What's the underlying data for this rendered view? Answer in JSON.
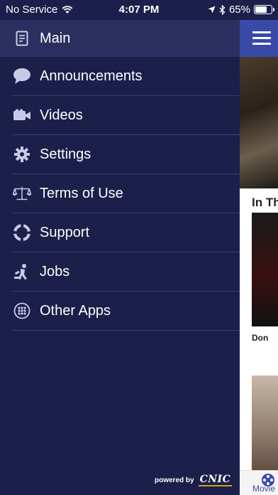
{
  "status": {
    "carrier": "No Service",
    "time": "4:07 PM",
    "battery": "65%",
    "battery_level": 0.65
  },
  "menu": [
    {
      "label": "Main",
      "icon": "document-icon",
      "active": true
    },
    {
      "label": "Announcements",
      "icon": "speech-bubble-icon"
    },
    {
      "label": "Videos",
      "icon": "video-camera-icon"
    },
    {
      "label": "Settings",
      "icon": "gear-icon"
    },
    {
      "label": "Terms of Use",
      "icon": "scales-icon"
    },
    {
      "label": "Support",
      "icon": "lifebuoy-icon"
    },
    {
      "label": "Jobs",
      "icon": "worker-icon"
    },
    {
      "label": "Other Apps",
      "icon": "apps-grid-icon"
    }
  ],
  "footer": {
    "powered_by": "powered by",
    "brand": "CNIC"
  },
  "content": {
    "section_title": "In Th",
    "poster_title": "Don",
    "tab_label": "Movie"
  },
  "colors": {
    "drawer_bg": "#1c1f4a",
    "active_item_bg": "#2b2f5f",
    "header_accent": "#3949a8",
    "icon_color": "#c8cbe6"
  }
}
